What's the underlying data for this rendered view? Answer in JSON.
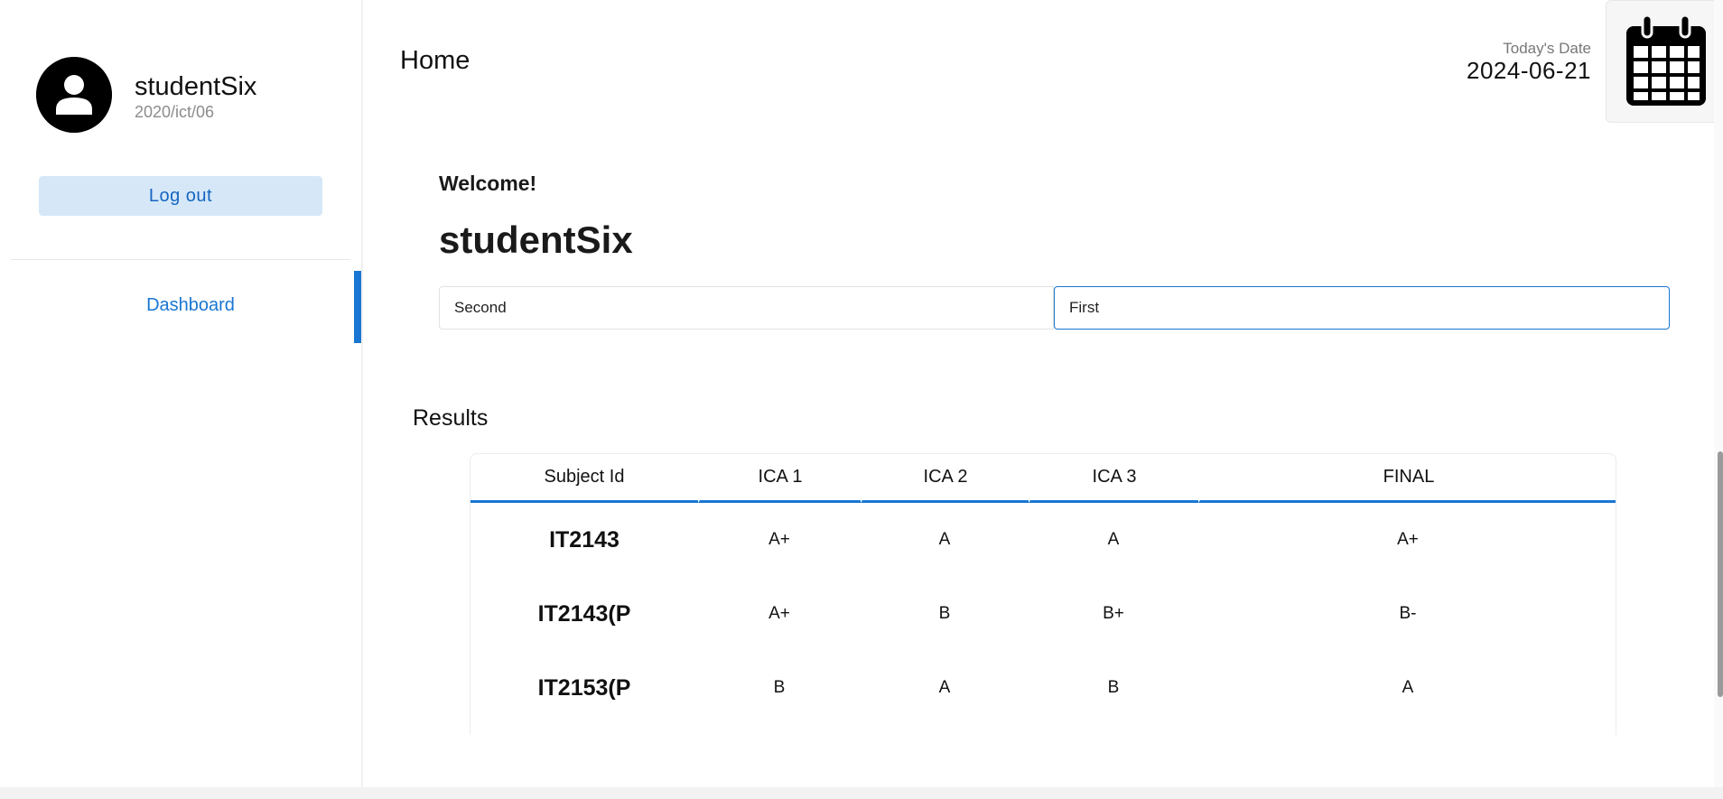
{
  "sidebar": {
    "user": {
      "name": "studentSix",
      "id": "2020/ict/06"
    },
    "logout_label": "Log out",
    "nav": [
      {
        "label": "Dashboard",
        "active": true
      }
    ]
  },
  "header": {
    "title": "Home",
    "date_label": "Today's Date",
    "date_value": "2024-06-21"
  },
  "main": {
    "welcome": "Welcome!",
    "student_name": "studentSix",
    "selects": {
      "year": "Second",
      "semester": "First"
    },
    "results": {
      "title": "Results",
      "columns": [
        "Subject Id",
        "ICA 1",
        "ICA 2",
        "ICA 3",
        "FINAL"
      ],
      "rows": [
        [
          "IT2143",
          "A+",
          "A",
          "A",
          "A+"
        ],
        [
          "IT2143(P",
          "A+",
          "B",
          "B+",
          "B-"
        ],
        [
          "IT2153(P",
          "B",
          "A",
          "B",
          "A"
        ]
      ]
    }
  },
  "colors": {
    "accent": "#1976d2",
    "button_bg": "#d6e8f8"
  },
  "icons": [
    "user-avatar-icon",
    "calendar-icon"
  ]
}
